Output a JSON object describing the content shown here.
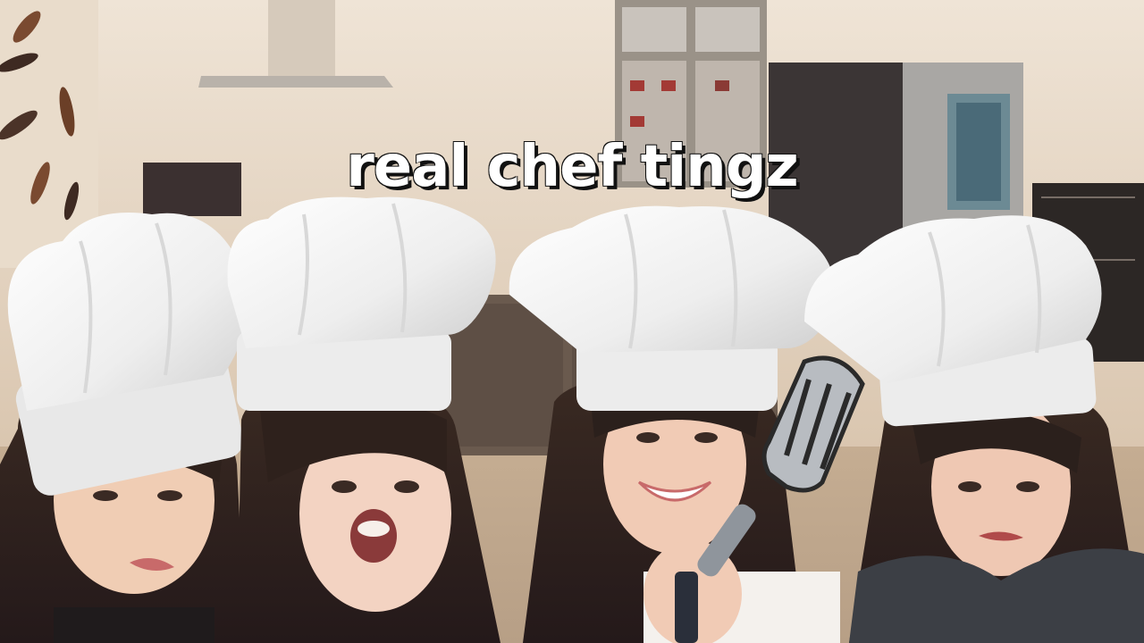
{
  "title": "real chef tingz",
  "colors": {
    "wall": "#e6d6c4",
    "floor": "#c9b39a",
    "cabinet": "#5a4a3f",
    "hat": "#f6f6f6",
    "hat_shadow": "#d4d4d4",
    "spatula": "#8f959c"
  },
  "people": [
    {
      "name": "person-1",
      "hat": "chef-hat-icon"
    },
    {
      "name": "person-2",
      "hat": "chef-hat-icon"
    },
    {
      "name": "person-3",
      "hat": "chef-hat-icon",
      "holding": "spatula-icon"
    },
    {
      "name": "person-4",
      "hat": "chef-hat-icon"
    }
  ]
}
